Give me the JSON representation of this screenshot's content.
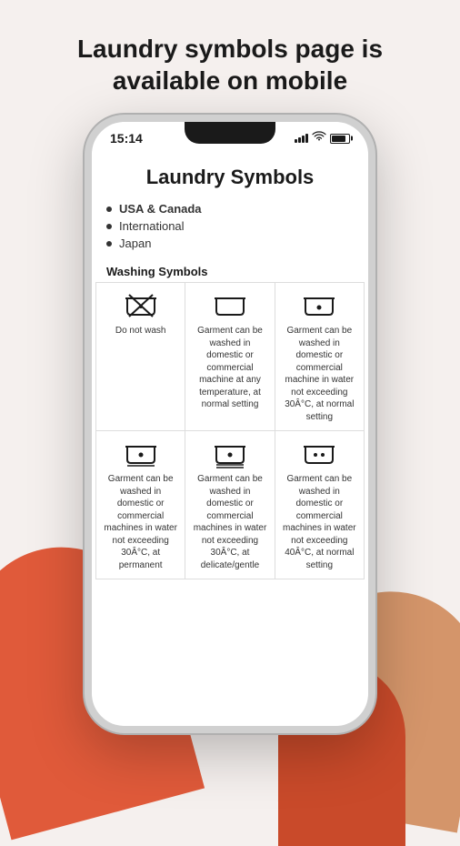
{
  "headline": "Laundry symbols page is available on mobile",
  "phone": {
    "status": {
      "time": "15:14"
    },
    "app_title": "Laundry Symbols",
    "nav": [
      {
        "label": "USA & Canada",
        "active": true
      },
      {
        "label": "International",
        "active": false
      },
      {
        "label": "Japan",
        "active": false
      }
    ],
    "section_header": "Washing Symbols",
    "rows": [
      {
        "cells": [
          {
            "icon_type": "do_not_wash",
            "text": "Do not wash"
          },
          {
            "icon_type": "wash_any",
            "text": "Garment can be washed in domestic or commercial machine at any temperature, at normal setting"
          },
          {
            "icon_type": "wash_30",
            "text": "Garment can be washed in domestic or commercial machine in water not exceeding 30Â°C, at normal setting"
          }
        ]
      },
      {
        "cells": [
          {
            "icon_type": "wash_30_perm",
            "text": "Garment can be washed in domestic or commercial machines in water not exceeding 30Â°C, at permanent"
          },
          {
            "icon_type": "wash_30_delicate",
            "text": "Garment can be washed in domestic or commercial machines in water not exceeding 30Â°C, at delicate/gentle"
          },
          {
            "icon_type": "wash_40",
            "text": "Garment can be washed in domestic or commercial machines in water not exceeding 40Â°C, at normal setting"
          }
        ]
      }
    ]
  }
}
